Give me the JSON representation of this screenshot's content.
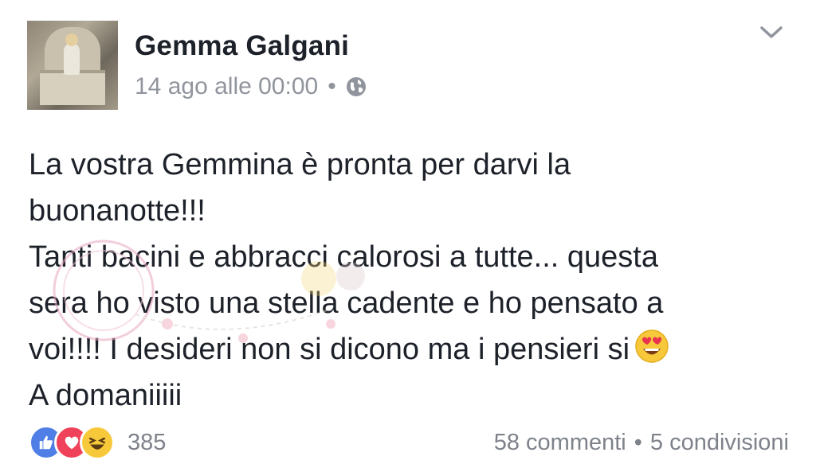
{
  "post": {
    "author": "Gemma Galgani",
    "timestamp": "14 ago alle 00:00",
    "separator": "•",
    "privacy_icon": "globe-icon",
    "body_lines": [
      "La vostra Gemmina è pronta per darvi la",
      "buonanotte!!!",
      "Tanti bacini e abbracci calorosi a tutte... questa",
      "sera ho visto una stella cadente e ho pensato a",
      "voi!!!! I desideri non si dicono ma i pensieri si",
      "A domaniiiii"
    ],
    "body_emoji": "heart-eyes-emoji"
  },
  "footer": {
    "reaction_icons": [
      "like-icon",
      "love-icon",
      "haha-icon"
    ],
    "reaction_count": "385",
    "comments": "58 commenti",
    "separator": "•",
    "shares": "5 condivisioni"
  },
  "colors": {
    "text": "#1d2129",
    "meta": "#90949c",
    "like": "#4f7fe6",
    "love": "#f0415a",
    "haha": "#f7c93a"
  }
}
